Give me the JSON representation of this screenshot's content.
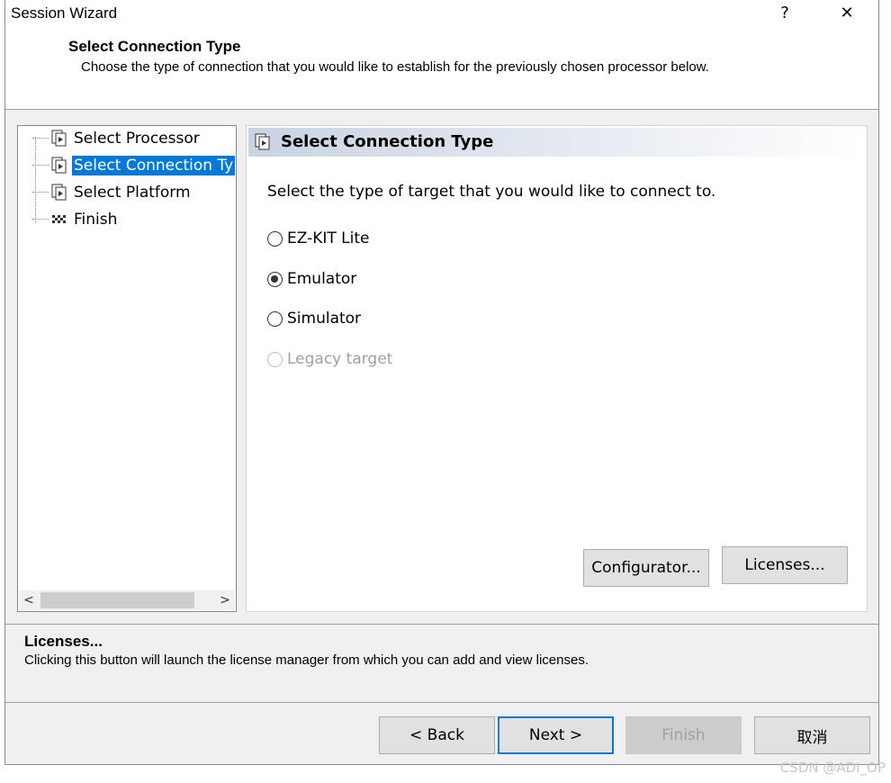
{
  "window": {
    "title": "Session Wizard",
    "help_label": "?",
    "close_label": "✕"
  },
  "header": {
    "title": "Select Connection Type",
    "subtitle": "Choose the type of connection that you would like to establish for the previously chosen processor below."
  },
  "tree": {
    "items": [
      {
        "label": "Select Processor",
        "icon": "page-play-icon",
        "selected": false
      },
      {
        "label": "Select Connection Ty",
        "icon": "page-play-icon",
        "selected": true
      },
      {
        "label": "Select Platform",
        "icon": "page-play-icon",
        "selected": false
      },
      {
        "label": "Finish",
        "icon": "checkered-flag-icon",
        "selected": false
      }
    ],
    "scroll_left": "<",
    "scroll_right": ">"
  },
  "content": {
    "title": "Select Connection Type",
    "prompt": "Select the type of target that you would like to connect to.",
    "options": [
      {
        "label": "EZ-KIT Lite",
        "checked": false,
        "disabled": false
      },
      {
        "label": "Emulator",
        "checked": true,
        "disabled": false
      },
      {
        "label": "Simulator",
        "checked": false,
        "disabled": false
      },
      {
        "label": "Legacy target",
        "checked": false,
        "disabled": true
      }
    ],
    "configurator_label": "Configurator...",
    "licenses_label": "Licenses..."
  },
  "description": {
    "title": "Licenses...",
    "text": "Clicking this button will launch the license manager from which you can add and view licenses."
  },
  "footer": {
    "back_label": "< Back",
    "next_label": "Next >",
    "finish_label": "Finish",
    "cancel_label": "取消"
  },
  "watermark": "CSDN @ADI_OP",
  "colors": {
    "selection": "#0078d7",
    "header_gradient_start": "#c9d3e2"
  }
}
